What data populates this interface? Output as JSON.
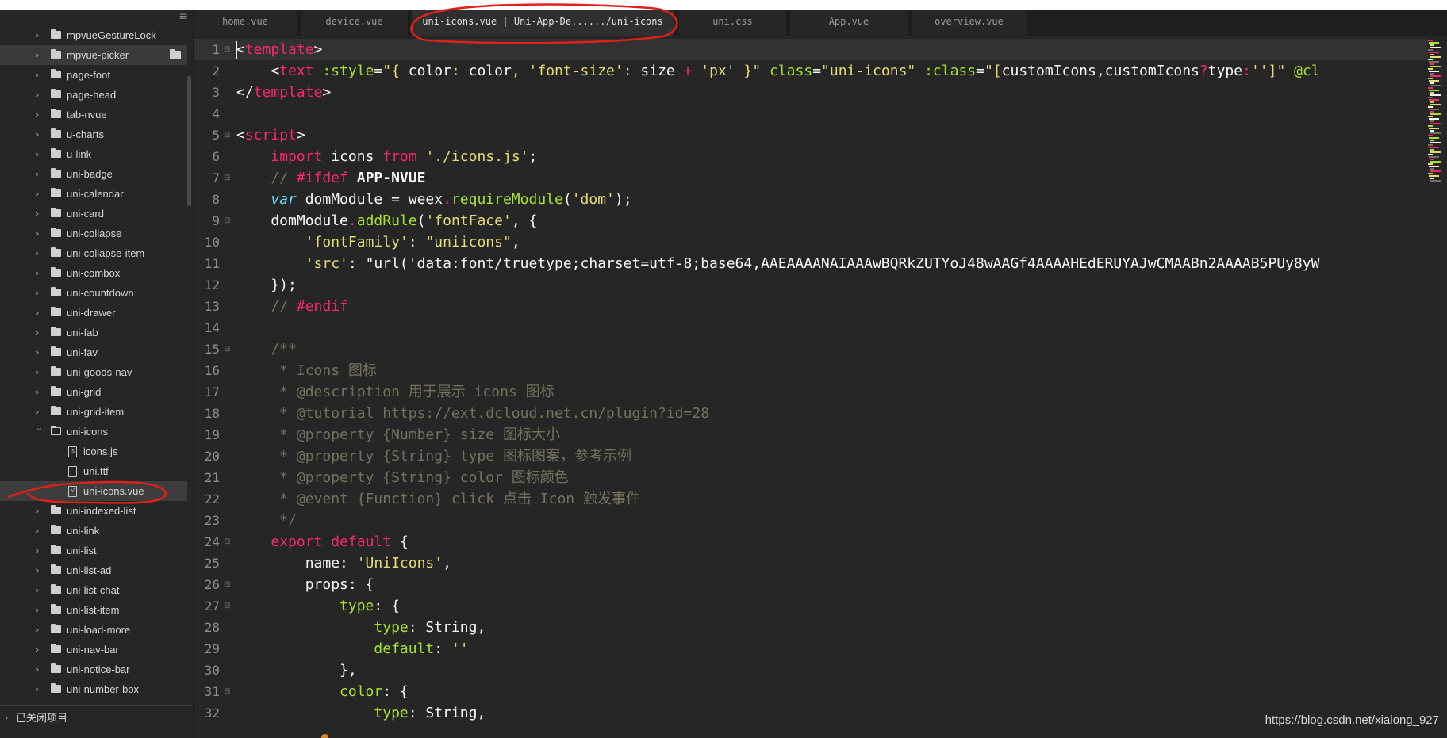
{
  "tabs": [
    {
      "label": "home.vue",
      "active": false
    },
    {
      "label": "device.vue",
      "active": false
    },
    {
      "label": "uni-icons.vue | Uni-App-De....../uni-icons",
      "active": true
    },
    {
      "label": "uni.css",
      "active": false
    },
    {
      "label": "App.vue",
      "active": false
    },
    {
      "label": "overview.vue",
      "active": false
    }
  ],
  "sidebar": {
    "menu_icon": "≡",
    "items": [
      {
        "label": "mpvueGestureLock",
        "type": "folder",
        "depth": 1,
        "expanded": false
      },
      {
        "label": "mpvue-picker",
        "type": "folder",
        "depth": 1,
        "expanded": false,
        "hovered": true
      },
      {
        "label": "page-foot",
        "type": "folder",
        "depth": 1,
        "expanded": false
      },
      {
        "label": "page-head",
        "type": "folder",
        "depth": 1,
        "expanded": false
      },
      {
        "label": "tab-nvue",
        "type": "folder",
        "depth": 1,
        "expanded": false
      },
      {
        "label": "u-charts",
        "type": "folder",
        "depth": 1,
        "expanded": false
      },
      {
        "label": "u-link",
        "type": "folder",
        "depth": 1,
        "expanded": false
      },
      {
        "label": "uni-badge",
        "type": "folder",
        "depth": 1,
        "expanded": false
      },
      {
        "label": "uni-calendar",
        "type": "folder",
        "depth": 1,
        "expanded": false
      },
      {
        "label": "uni-card",
        "type": "folder",
        "depth": 1,
        "expanded": false
      },
      {
        "label": "uni-collapse",
        "type": "folder",
        "depth": 1,
        "expanded": false
      },
      {
        "label": "uni-collapse-item",
        "type": "folder",
        "depth": 1,
        "expanded": false
      },
      {
        "label": "uni-combox",
        "type": "folder",
        "depth": 1,
        "expanded": false
      },
      {
        "label": "uni-countdown",
        "type": "folder",
        "depth": 1,
        "expanded": false
      },
      {
        "label": "uni-drawer",
        "type": "folder",
        "depth": 1,
        "expanded": false
      },
      {
        "label": "uni-fab",
        "type": "folder",
        "depth": 1,
        "expanded": false
      },
      {
        "label": "uni-fav",
        "type": "folder",
        "depth": 1,
        "expanded": false
      },
      {
        "label": "uni-goods-nav",
        "type": "folder",
        "depth": 1,
        "expanded": false
      },
      {
        "label": "uni-grid",
        "type": "folder",
        "depth": 1,
        "expanded": false
      },
      {
        "label": "uni-grid-item",
        "type": "folder",
        "depth": 1,
        "expanded": false
      },
      {
        "label": "uni-icons",
        "type": "folder",
        "depth": 1,
        "expanded": true
      },
      {
        "label": "icons.js",
        "type": "file",
        "depth": 2,
        "glyph": "js"
      },
      {
        "label": "uni.ttf",
        "type": "file",
        "depth": 2,
        "glyph": ""
      },
      {
        "label": "uni-icons.vue",
        "type": "file",
        "depth": 2,
        "glyph": "V",
        "selected": true
      },
      {
        "label": "uni-indexed-list",
        "type": "folder",
        "depth": 1,
        "expanded": false
      },
      {
        "label": "uni-link",
        "type": "folder",
        "depth": 1,
        "expanded": false
      },
      {
        "label": "uni-list",
        "type": "folder",
        "depth": 1,
        "expanded": false
      },
      {
        "label": "uni-list-ad",
        "type": "folder",
        "depth": 1,
        "expanded": false
      },
      {
        "label": "uni-list-chat",
        "type": "folder",
        "depth": 1,
        "expanded": false
      },
      {
        "label": "uni-list-item",
        "type": "folder",
        "depth": 1,
        "expanded": false
      },
      {
        "label": "uni-load-more",
        "type": "folder",
        "depth": 1,
        "expanded": false
      },
      {
        "label": "uni-nav-bar",
        "type": "folder",
        "depth": 1,
        "expanded": false
      },
      {
        "label": "uni-notice-bar",
        "type": "folder",
        "depth": 1,
        "expanded": false
      },
      {
        "label": "uni-number-box",
        "type": "folder",
        "depth": 1,
        "expanded": false
      }
    ],
    "closed_projects_label": "已关闭项目"
  },
  "editor": {
    "lines": [
      {
        "n": "1",
        "fold": "⊟",
        "tokens": [
          [
            "c-punct",
            "<"
          ],
          [
            "c-tag",
            "template"
          ],
          [
            "c-punct",
            ">"
          ]
        ]
      },
      {
        "n": "2",
        "fold": "",
        "tokens": [
          [
            "c-plain",
            "    <"
          ],
          [
            "c-tag",
            "text"
          ],
          [
            "c-attr",
            " :style"
          ],
          [
            "c-plain",
            "="
          ],
          [
            "c-str",
            "\"{ "
          ],
          [
            "c-plain",
            "color"
          ],
          [
            "c-str",
            ": "
          ],
          [
            "c-plain",
            "color"
          ],
          [
            "c-str",
            ", "
          ],
          [
            "c-str",
            "'font-size'"
          ],
          [
            "c-str",
            ": "
          ],
          [
            "c-plain",
            "size "
          ],
          [
            "c-kw",
            "+"
          ],
          [
            "c-str",
            " 'px'"
          ],
          [
            "c-str",
            " }\""
          ],
          [
            "c-attr",
            " class"
          ],
          [
            "c-plain",
            "="
          ],
          [
            "c-str",
            "\"uni-icons\""
          ],
          [
            "c-attr",
            " :class"
          ],
          [
            "c-plain",
            "="
          ],
          [
            "c-str",
            "\"["
          ],
          [
            "c-plain",
            "customIcons,customIcons"
          ],
          [
            "c-kw",
            "?"
          ],
          [
            "c-plain",
            "type"
          ],
          [
            "c-kw",
            ":"
          ],
          [
            "c-str",
            "''"
          ],
          [
            "c-str",
            "]\""
          ],
          [
            "c-attr",
            " @cl"
          ]
        ]
      },
      {
        "n": "3",
        "fold": "",
        "tokens": [
          [
            "c-punct",
            "</"
          ],
          [
            "c-tag",
            "template"
          ],
          [
            "c-punct",
            ">"
          ]
        ]
      },
      {
        "n": "4",
        "fold": "",
        "tokens": []
      },
      {
        "n": "5",
        "fold": "⊟",
        "tokens": [
          [
            "c-punct",
            "<"
          ],
          [
            "c-tag",
            "script"
          ],
          [
            "c-punct",
            ">"
          ]
        ]
      },
      {
        "n": "6",
        "fold": "",
        "tokens": [
          [
            "c-plain",
            "    "
          ],
          [
            "c-kw",
            "import"
          ],
          [
            "c-plain",
            " icons "
          ],
          [
            "c-kw",
            "from"
          ],
          [
            "c-str",
            " './icons.js'"
          ],
          [
            "c-plain",
            ";"
          ]
        ]
      },
      {
        "n": "7",
        "fold": "⊟",
        "tokens": [
          [
            "c-plain",
            "    "
          ],
          [
            "c-comment",
            "// "
          ],
          [
            "c-kw",
            "#ifdef"
          ],
          [
            "c-bold",
            " APP-NVUE"
          ]
        ]
      },
      {
        "n": "8",
        "fold": "",
        "tokens": [
          [
            "c-plain",
            "    "
          ],
          [
            "c-var",
            "var"
          ],
          [
            "c-plain",
            " domModule = weex"
          ],
          [
            "c-kw",
            "."
          ],
          [
            "c-fn",
            "requireModule"
          ],
          [
            "c-plain",
            "("
          ],
          [
            "c-str",
            "'dom'"
          ],
          [
            "c-plain",
            ");"
          ]
        ]
      },
      {
        "n": "9",
        "fold": "⊟",
        "tokens": [
          [
            "c-plain",
            "    domModule"
          ],
          [
            "c-kw",
            "."
          ],
          [
            "c-fn",
            "addRule"
          ],
          [
            "c-plain",
            "("
          ],
          [
            "c-str",
            "'fontFace'"
          ],
          [
            "c-plain",
            ", {"
          ]
        ]
      },
      {
        "n": "10",
        "fold": "",
        "tokens": [
          [
            "c-plain",
            "        "
          ],
          [
            "c-str",
            "'fontFamily'"
          ],
          [
            "c-plain",
            ": "
          ],
          [
            "c-str",
            "\"uniicons\""
          ],
          [
            "c-plain",
            ","
          ]
        ]
      },
      {
        "n": "11",
        "fold": "",
        "tokens": [
          [
            "c-plain",
            "        "
          ],
          [
            "c-str",
            "'src'"
          ],
          [
            "c-plain",
            ": \"url('data:font/truetype;charset=utf-8;base64,AAEAAAANAIAAAwBQRkZUTYoJ48wAAGf4AAAAHEdERUYAJwCMAABn2AAAAB5PUy8yW"
          ]
        ]
      },
      {
        "n": "12",
        "fold": "",
        "tokens": [
          [
            "c-plain",
            "    });"
          ]
        ]
      },
      {
        "n": "13",
        "fold": "",
        "tokens": [
          [
            "c-plain",
            "    "
          ],
          [
            "c-comment",
            "// "
          ],
          [
            "c-kw",
            "#endif"
          ]
        ]
      },
      {
        "n": "14",
        "fold": "",
        "tokens": []
      },
      {
        "n": "15",
        "fold": "⊟",
        "tokens": [
          [
            "c-comment",
            "    /**"
          ]
        ]
      },
      {
        "n": "16",
        "fold": "",
        "tokens": [
          [
            "c-comment",
            "     * Icons 图标"
          ]
        ]
      },
      {
        "n": "17",
        "fold": "",
        "tokens": [
          [
            "c-comment",
            "     * @description 用于展示 icons 图标"
          ]
        ]
      },
      {
        "n": "18",
        "fold": "",
        "tokens": [
          [
            "c-comment",
            "     * @tutorial https://ext.dcloud.net.cn/plugin?id=28"
          ]
        ]
      },
      {
        "n": "19",
        "fold": "",
        "tokens": [
          [
            "c-comment",
            "     * @property {Number} size 图标大小"
          ]
        ]
      },
      {
        "n": "20",
        "fold": "",
        "tokens": [
          [
            "c-comment",
            "     * @property {String} type 图标图案，参考示例"
          ]
        ]
      },
      {
        "n": "21",
        "fold": "",
        "tokens": [
          [
            "c-comment",
            "     * @property {String} color 图标颜色"
          ]
        ]
      },
      {
        "n": "22",
        "fold": "",
        "tokens": [
          [
            "c-comment",
            "     * @event {Function} click 点击 Icon 触发事件"
          ]
        ]
      },
      {
        "n": "23",
        "fold": "",
        "tokens": [
          [
            "c-comment",
            "     */"
          ]
        ]
      },
      {
        "n": "24",
        "fold": "⊟",
        "tokens": [
          [
            "c-plain",
            "    "
          ],
          [
            "c-kw",
            "export"
          ],
          [
            "c-plain",
            " "
          ],
          [
            "c-kw",
            "default"
          ],
          [
            "c-plain",
            " {"
          ]
        ]
      },
      {
        "n": "25",
        "fold": "",
        "tokens": [
          [
            "c-plain",
            "        name: "
          ],
          [
            "c-str",
            "'UniIcons'"
          ],
          [
            "c-plain",
            ","
          ]
        ]
      },
      {
        "n": "26",
        "fold": "⊟",
        "tokens": [
          [
            "c-plain",
            "        props: {"
          ]
        ]
      },
      {
        "n": "27",
        "fold": "⊟",
        "tokens": [
          [
            "c-plain",
            "            "
          ],
          [
            "c-prop",
            "type"
          ],
          [
            "c-plain",
            ": {"
          ]
        ]
      },
      {
        "n": "28",
        "fold": "",
        "tokens": [
          [
            "c-plain",
            "                "
          ],
          [
            "c-prop",
            "type"
          ],
          [
            "c-plain",
            ": String,"
          ]
        ]
      },
      {
        "n": "29",
        "fold": "",
        "tokens": [
          [
            "c-plain",
            "                "
          ],
          [
            "c-prop",
            "default"
          ],
          [
            "c-plain",
            ": "
          ],
          [
            "c-str",
            "''"
          ]
        ]
      },
      {
        "n": "30",
        "fold": "",
        "tokens": [
          [
            "c-plain",
            "            },"
          ]
        ]
      },
      {
        "n": "31",
        "fold": "⊟",
        "tokens": [
          [
            "c-plain",
            "            "
          ],
          [
            "c-prop",
            "color"
          ],
          [
            "c-plain",
            ": {"
          ]
        ]
      },
      {
        "n": "32",
        "fold": "",
        "tokens": [
          [
            "c-plain",
            "                "
          ],
          [
            "c-prop",
            "type"
          ],
          [
            "c-plain",
            ": String,"
          ]
        ]
      }
    ]
  },
  "watermark": "https://blog.csdn.net/xialong_927",
  "colors": {
    "tag": "#f92672",
    "attr": "#a6e22e",
    "string": "#e6db74",
    "comment": "#75715e",
    "annotation": "#e0201a"
  },
  "icons": {
    "folder": "folder-icon",
    "chevron_right": "chevron-right-icon",
    "chevron_down": "chevron-down-icon",
    "fold_marker": "fold-icon",
    "menu": "menu-icon"
  }
}
